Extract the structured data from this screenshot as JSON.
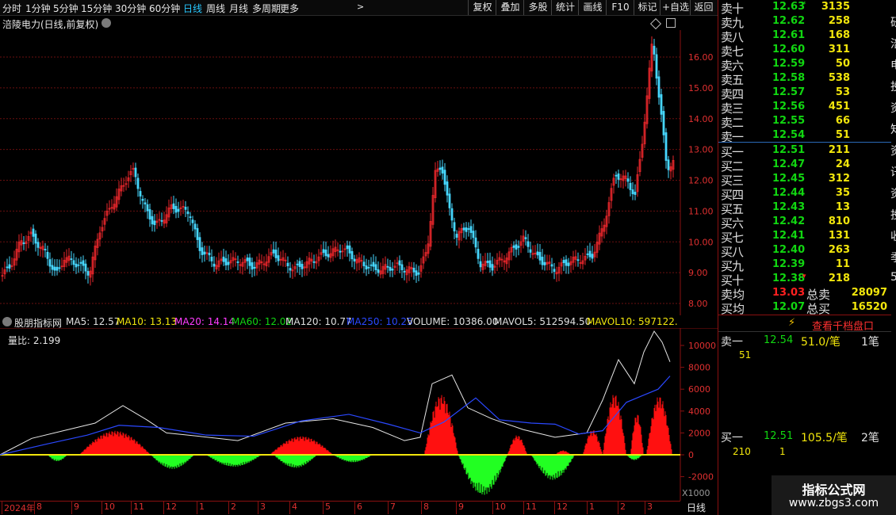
{
  "toolbar": {
    "periods": [
      {
        "label": "分时",
        "active": false
      },
      {
        "label": "1分钟",
        "active": false
      },
      {
        "label": "5分钟",
        "active": false
      },
      {
        "label": "15分钟",
        "active": false
      },
      {
        "label": "30分钟",
        "active": false
      },
      {
        "label": "60分钟",
        "active": false
      },
      {
        "label": "日线",
        "active": true
      },
      {
        "label": "周线",
        "active": false
      },
      {
        "label": "月线",
        "active": false
      },
      {
        "label": "多周期",
        "active": false
      },
      {
        "label": "更多",
        "active": false
      }
    ],
    "buttons": [
      "复权",
      "叠加",
      "多股",
      "统计",
      "画线",
      "F10",
      "标记",
      "+自选",
      "返回"
    ]
  },
  "stock_title": "涪陵电力(日线,前复权)",
  "price_axis": [
    "16.00",
    "15.00",
    "14.00",
    "13.00",
    "12.00",
    "11.00",
    "10.00",
    "9.00",
    "8.00"
  ],
  "indicator": {
    "name": "股朋指标网",
    "ma": [
      {
        "label": "MA5: 12.57",
        "color": "#e0e0e0"
      },
      {
        "label": "MA10: 13.13",
        "color": "#f2e60c"
      },
      {
        "label": "MA20: 14.14",
        "color": "#ff3cff"
      },
      {
        "label": "MA60: 12.02",
        "color": "#11d611"
      },
      {
        "label": "MA120: 10.77",
        "color": "#e0e0e0"
      },
      {
        "label": "MA250: 10.25",
        "color": "#2a48ff"
      },
      {
        "label": "VOLUME: 10386.00",
        "color": "#e0e0e0"
      },
      {
        "label": "MAVOL5: 512594.50",
        "color": "#e0e0e0"
      },
      {
        "label": "MAVOL10: 597122.",
        "color": "#f2e60c"
      }
    ],
    "ratio": "量比:  2.199",
    "axis": [
      "10000",
      "8000",
      "6000",
      "4000",
      "2000",
      "0",
      "-2000"
    ],
    "unit": "X1000"
  },
  "bottom_label": "日线",
  "date_axis": [
    {
      "label": "2024年",
      "color": "#e03030"
    },
    {
      "label": "8",
      "color": "#e03030"
    },
    {
      "label": "9",
      "color": "#e03030"
    },
    {
      "label": "10",
      "color": "#e03030"
    },
    {
      "label": "11",
      "color": "#e03030"
    },
    {
      "label": "12",
      "color": "#e03030"
    },
    {
      "label": "1",
      "color": "#e03030"
    },
    {
      "label": "2",
      "color": "#e03030"
    },
    {
      "label": "3",
      "color": "#e03030"
    },
    {
      "label": "4",
      "color": "#e03030"
    },
    {
      "label": "5",
      "color": "#e03030"
    },
    {
      "label": "6",
      "color": "#e03030"
    },
    {
      "label": "7",
      "color": "#e03030"
    },
    {
      "label": "8",
      "color": "#e03030"
    },
    {
      "label": "9",
      "color": "#e03030"
    },
    {
      "label": "10",
      "color": "#e03030"
    },
    {
      "label": "11",
      "color": "#e03030"
    },
    {
      "label": "12",
      "color": "#e03030"
    },
    {
      "label": "1",
      "color": "#e03030"
    },
    {
      "label": "2",
      "color": "#e03030"
    },
    {
      "label": "3",
      "color": "#e03030"
    }
  ],
  "orderbook": {
    "asks": [
      {
        "label": "卖十",
        "price": "12.63",
        "vol": "3135"
      },
      {
        "label": "卖九",
        "price": "12.62",
        "vol": "258"
      },
      {
        "label": "卖八",
        "price": "12.61",
        "vol": "168"
      },
      {
        "label": "卖七",
        "price": "12.60",
        "vol": "311"
      },
      {
        "label": "卖六",
        "price": "12.59",
        "vol": "50"
      },
      {
        "label": "卖五",
        "price": "12.58",
        "vol": "538"
      },
      {
        "label": "卖四",
        "price": "12.57",
        "vol": "53"
      },
      {
        "label": "卖三",
        "price": "12.56",
        "vol": "451"
      },
      {
        "label": "卖二",
        "price": "12.55",
        "vol": "66"
      },
      {
        "label": "卖一",
        "price": "12.54",
        "vol": "51"
      }
    ],
    "bids": [
      {
        "label": "买一",
        "price": "12.51",
        "vol": "211"
      },
      {
        "label": "买二",
        "price": "12.47",
        "vol": "24"
      },
      {
        "label": "买三",
        "price": "12.45",
        "vol": "312"
      },
      {
        "label": "买四",
        "price": "12.44",
        "vol": "35"
      },
      {
        "label": "买五",
        "price": "12.43",
        "vol": "13"
      },
      {
        "label": "买六",
        "price": "12.42",
        "vol": "810"
      },
      {
        "label": "买七",
        "price": "12.41",
        "vol": "131"
      },
      {
        "label": "买八",
        "price": "12.40",
        "vol": "263"
      },
      {
        "label": "买九",
        "price": "12.39",
        "vol": "11"
      },
      {
        "label": "买十",
        "price": "12.38",
        "vol": "218"
      }
    ],
    "ask_avg_label": "卖均",
    "ask_avg": "13.03",
    "ask_total_label": "总卖",
    "ask_total": "28097",
    "bid_avg_label": "买均",
    "bid_avg": "12.07",
    "bid_total_label": "总买",
    "bid_total": "16520"
  },
  "qiandang_label": "查看千档盘口",
  "queue": {
    "sell_label": "卖一",
    "sell_price": "12.54",
    "sell_amt": "51.0/笔",
    "sell_count": "1笔",
    "sell_q": "51",
    "buy_label": "买一",
    "buy_price": "12.51",
    "buy_amt": "105.5/笔",
    "buy_count": "2笔",
    "buy_q1": "210",
    "buy_q2": "1"
  },
  "side_chars": [
    "研",
    "涪",
    "电",
    "投",
    "资",
    "知",
    "资",
    "讯",
    "资",
    "投",
    "收",
    "季",
    "5"
  ],
  "watermark": {
    "title": "指标公式网",
    "url": "www.zbgs3.com"
  },
  "colors": {
    "up": "#e8262b",
    "down": "#46d7ff",
    "volume_up": "#ff1010",
    "volume_down": "#22ff22",
    "grid": "#6a0f0f"
  }
}
